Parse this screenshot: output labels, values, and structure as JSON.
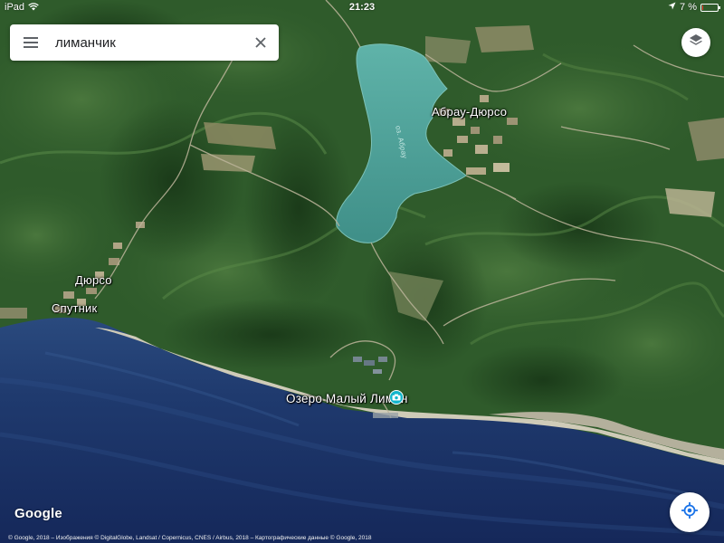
{
  "status_bar": {
    "device": "iPad",
    "time": "21:23",
    "battery_percent": "7 %",
    "battery_level": 0.07
  },
  "search": {
    "query": "лиманчик"
  },
  "map": {
    "type": "satellite",
    "labels": {
      "abrau_dyurso": "Абрау-Дюрсо",
      "lake_abrau": "оз. Абрау",
      "dyurso": "Дюрсо",
      "sputnik": "Спутник",
      "poi_name": "Озеро Малый Лиман"
    },
    "colors": {
      "sea": "#1a2f64",
      "lake": "#4fa49c",
      "forest": "#2f5b2b",
      "beach": "#c9c6b6",
      "poi": "#12b5cb"
    }
  },
  "icons": {
    "menu": "menu-icon",
    "clear": "close-icon",
    "layers": "layers-icon",
    "my_location": "my-location-icon",
    "poi": "camera-icon"
  },
  "footer": {
    "logo": "Google",
    "attribution": "© Google, 2018 – Изображения © DigitalGlobe, Landsat / Copernicus, CNES / Airbus, 2018 – Картографические данные © Google, 2018"
  }
}
